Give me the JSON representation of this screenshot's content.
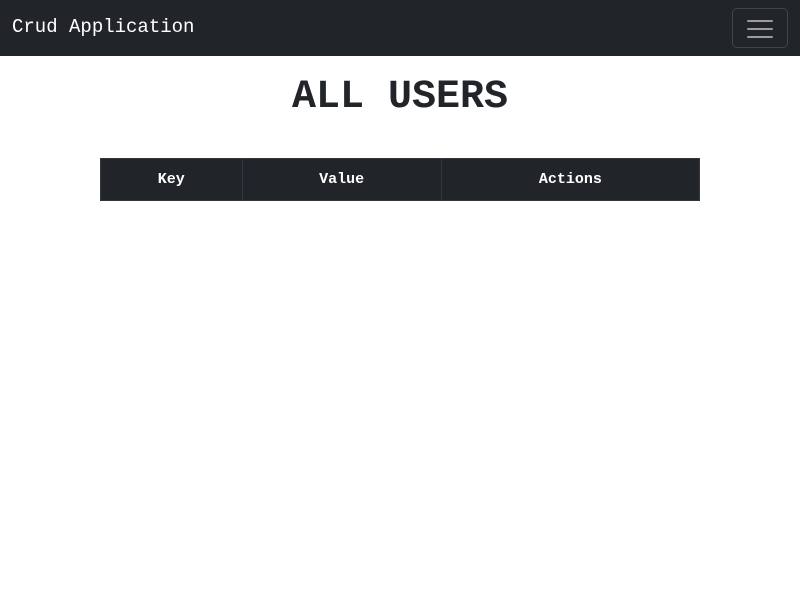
{
  "navbar": {
    "brand": "Crud Application",
    "toggler_icon": "hamburger-menu-icon",
    "background": "#212529"
  },
  "main": {
    "title": "ALL USERS"
  },
  "table": {
    "columns": [
      "Key",
      "Value",
      "Actions"
    ],
    "rows": [],
    "header_background": "#212529"
  }
}
